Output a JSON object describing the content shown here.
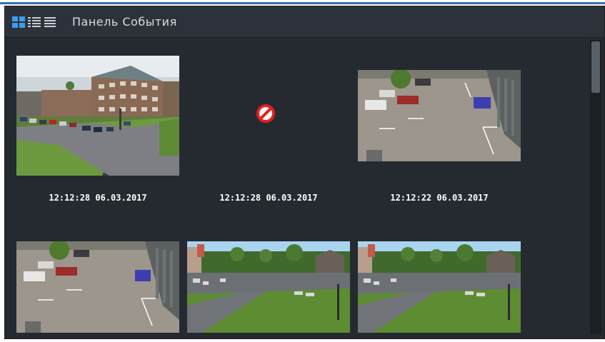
{
  "header": {
    "title": "Панель События",
    "view_icons": [
      "grid-view-icon",
      "detailed-list-view-icon",
      "list-view-icon"
    ],
    "active_view": "grid-view-icon"
  },
  "events": [
    {
      "timestamp": "12:12:28 06.03.2017",
      "image": "building-parking-camera"
    },
    {
      "timestamp": "12:12:28 06.03.2017",
      "image": "no-image-icon"
    },
    {
      "timestamp": "12:12:22 06.03.2017",
      "image": "parking-lot-top-camera"
    },
    {
      "timestamp": "",
      "image": "parking-lot-top-camera"
    },
    {
      "timestamp": "",
      "image": "lawn-street-camera"
    },
    {
      "timestamp": "",
      "image": "lawn-street-camera"
    }
  ],
  "colors": {
    "panel_bg": "#252a30",
    "header_bg": "#2d323a",
    "active_icon": "#3b9df2",
    "no_image": "#e02020"
  }
}
